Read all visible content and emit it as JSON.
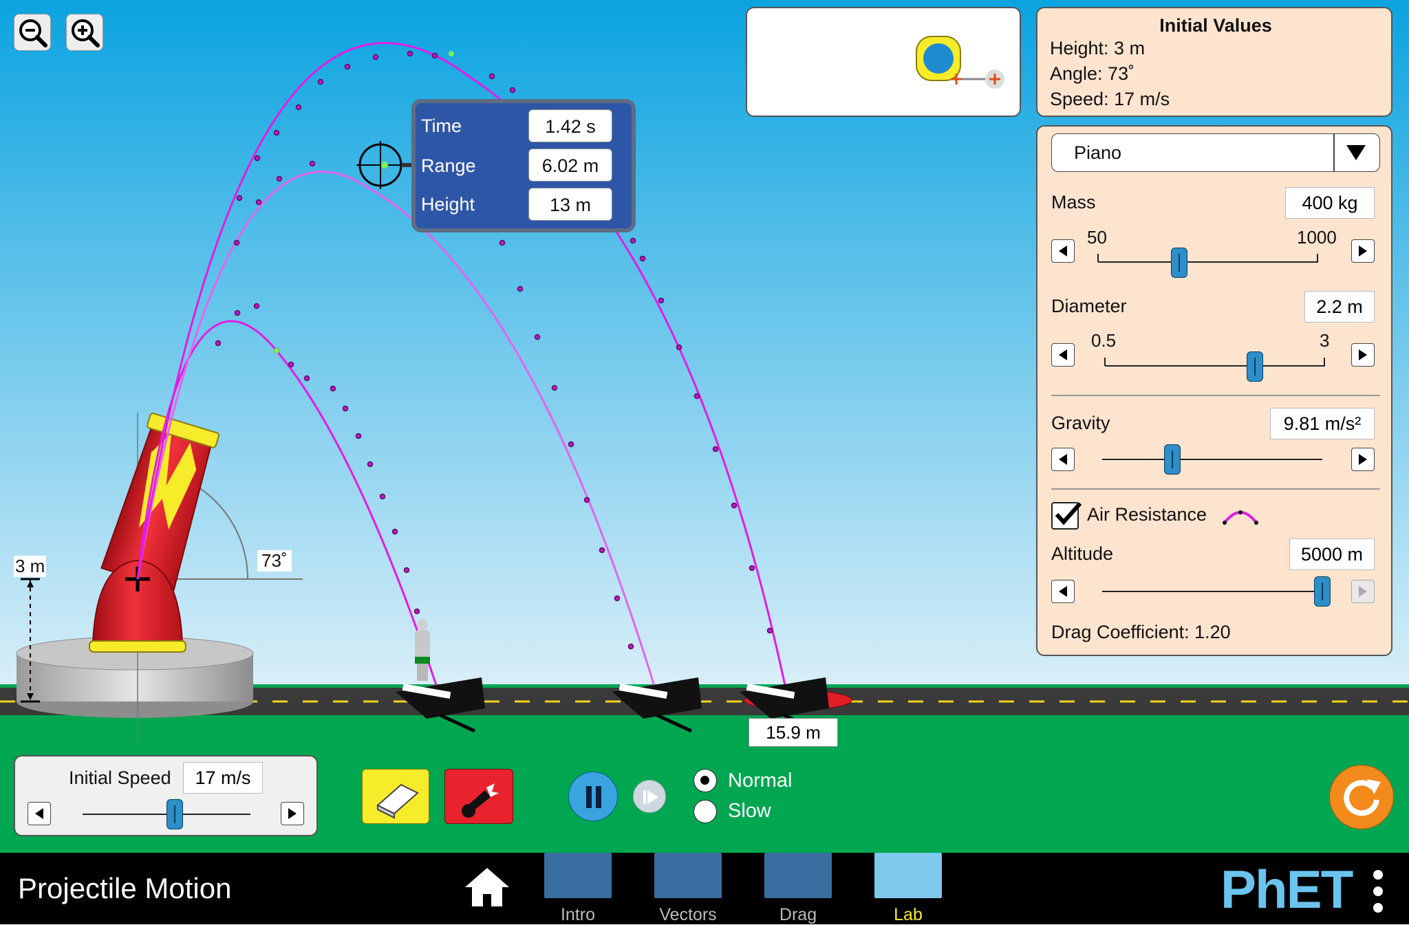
{
  "colors": {
    "sky": "#12a7e1",
    "ground": "#00a650",
    "navbar": "#000000",
    "panel": "#fde4cf",
    "trajectory": "#e21ce6",
    "thumb": "#2d8ec9",
    "play_button": "#3aa4e0",
    "reset_button": "#f28a1c",
    "erase_button": "#f7ec2a",
    "fire_button": "#e8232d"
  },
  "cannon": {
    "height_label": "3 m",
    "angle_label": "73˚"
  },
  "zoom": {
    "zoom_out_icon": "magnifier-minus-icon",
    "zoom_in_icon": "magnifier-plus-icon"
  },
  "toolbox": {
    "tape_measure_icon": "tape-measure-icon"
  },
  "initial_values": {
    "title": "Initial Values",
    "height": "Height: 3 m",
    "angle": "Angle: 73˚",
    "speed": "Speed: 17 m/s"
  },
  "measure_dialog": {
    "time_label": "Time",
    "time_value": "1.42 s",
    "range_label": "Range",
    "range_value": "6.02 m",
    "height_label": "Height",
    "height_value": "13 m"
  },
  "landing_readout": "15.9 m",
  "controls": {
    "projectile_select": "Piano",
    "mass_label": "Mass",
    "mass_value": "400 kg",
    "mass_min": "50",
    "mass_max": "1000",
    "mass_level": 0.37,
    "diameter_label": "Diameter",
    "diameter_value": "2.2 m",
    "diameter_min": "0.5",
    "diameter_max": "3",
    "diameter_level": 0.68,
    "gravity_label": "Gravity",
    "gravity_value": "9.81 m/s²",
    "gravity_level": 0.32,
    "air_resistance_label": "Air Resistance",
    "air_resistance_checked": true,
    "altitude_label": "Altitude",
    "altitude_value": "5000 m",
    "altitude_level": 1.0,
    "drag_coefficient": "Drag Coefficient: 1.20"
  },
  "initial_speed": {
    "label": "Initial Speed",
    "value": "17 m/s",
    "level": 0.55
  },
  "playback": {
    "normal_label": "Normal",
    "slow_label": "Slow",
    "selected": "Normal"
  },
  "navbar": {
    "title": "Projectile Motion",
    "tabs": [
      "Intro",
      "Vectors",
      "Drag",
      "Lab"
    ],
    "active_tab": "Lab",
    "brand": "PhET"
  }
}
